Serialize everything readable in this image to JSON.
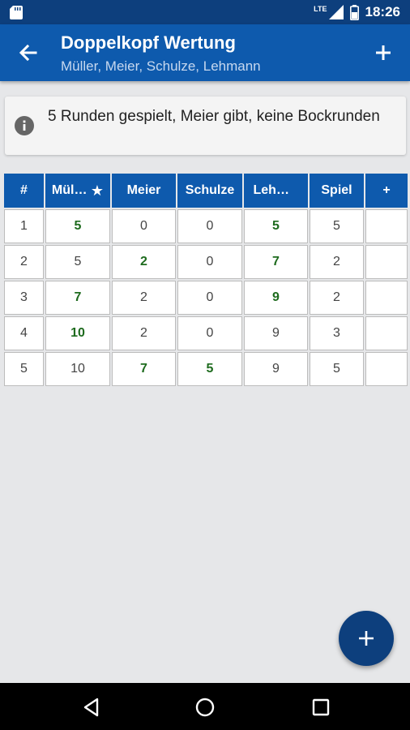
{
  "status_bar": {
    "network": "LTE",
    "time": "18:26",
    "colors": {
      "background": "#0d3f7d"
    }
  },
  "app_bar": {
    "title": "Doppelkopf Wertung",
    "subtitle": "Müller, Meier, Schulze, Lehmann",
    "colors": {
      "background": "#0e5aad",
      "subtitle": "#c7d8ef"
    }
  },
  "info": {
    "text": "5 Runden gespielt, Meier gibt, keine Bockrunden"
  },
  "table": {
    "headers": [
      "#",
      "Müller",
      "Meier",
      "Schulze",
      "Lehmann",
      "Spiel",
      "+"
    ],
    "dealer_marker": "★",
    "rows": [
      {
        "round": "1",
        "scores": [
          "5",
          "0",
          "0",
          "5"
        ],
        "spiel": "5",
        "winners": [
          true,
          false,
          false,
          true
        ]
      },
      {
        "round": "2",
        "scores": [
          "5",
          "2",
          "0",
          "7"
        ],
        "spiel": "2",
        "winners": [
          false,
          true,
          false,
          true
        ]
      },
      {
        "round": "3",
        "scores": [
          "7",
          "2",
          "0",
          "9"
        ],
        "spiel": "2",
        "winners": [
          true,
          false,
          false,
          true
        ]
      },
      {
        "round": "4",
        "scores": [
          "10",
          "2",
          "0",
          "9"
        ],
        "spiel": "3",
        "winners": [
          true,
          false,
          false,
          false
        ]
      },
      {
        "round": "5",
        "scores": [
          "10",
          "7",
          "5",
          "9"
        ],
        "spiel": "5",
        "winners": [
          false,
          true,
          true,
          false
        ]
      }
    ],
    "colors": {
      "header": "#0e5aad",
      "win_text": "#1e6b1e"
    }
  },
  "fab": {
    "icon": "plus-icon",
    "color": "#0d3f7d"
  },
  "nav_bar": {
    "icons": [
      "back-triangle-icon",
      "home-circle-icon",
      "recents-square-icon"
    ]
  }
}
